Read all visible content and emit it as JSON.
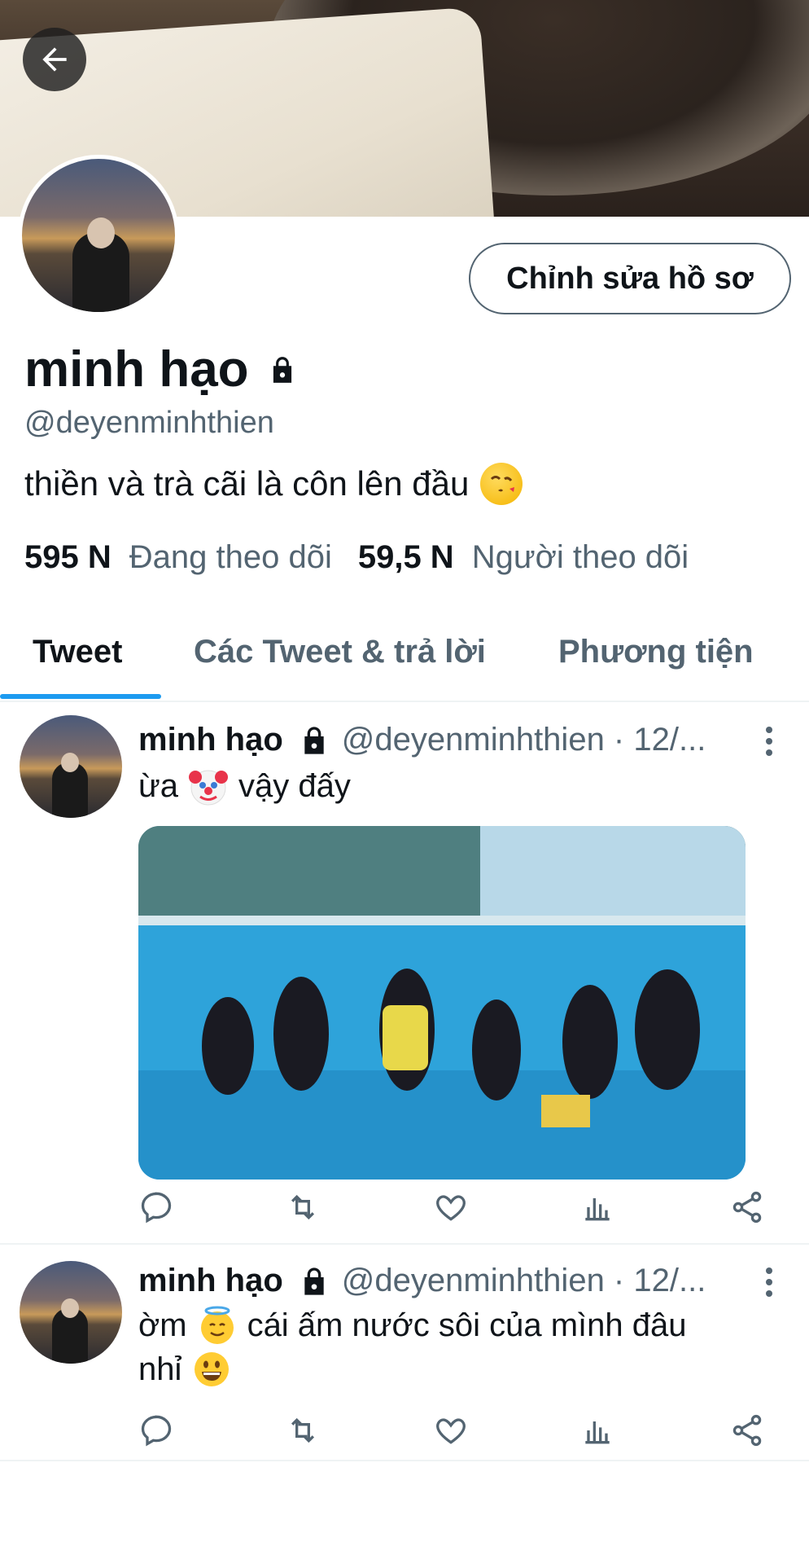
{
  "profile": {
    "edit_label": "Chỉnh sửa hồ sơ",
    "name": "minh hạo",
    "handle": "@deyenminhthien",
    "bio": "thiền và trà cãi là côn lên đầu",
    "following_count": "595 N",
    "following_label": "Đang theo dõi",
    "followers_count": "59,5 N",
    "followers_label": "Người theo dõi"
  },
  "tabs": [
    {
      "label": "Tweet",
      "active": true
    },
    {
      "label": "Các Tweet & trả lời",
      "active": false
    },
    {
      "label": "Phương tiện",
      "active": false
    }
  ],
  "tweets": [
    {
      "name": "minh hạo",
      "handle_date": "@deyenminhthien · 12/...",
      "text_before": "ừa",
      "emoji": "clown-face",
      "text_after": "vậy đấy",
      "has_media": true
    },
    {
      "name": "minh hạo",
      "handle_date": "@deyenminhthien · 12/...",
      "text_before": "ờm",
      "emoji": "smiling-face-with-halo",
      "text_after": "cái ấm nước sôi của mình đâu",
      "text_line2": "nhỉ",
      "emoji2": "grinning-face",
      "has_media": false
    }
  ],
  "colors": {
    "accent": "#1d9bf0",
    "text_primary": "#0f1419",
    "text_secondary": "#536471"
  }
}
